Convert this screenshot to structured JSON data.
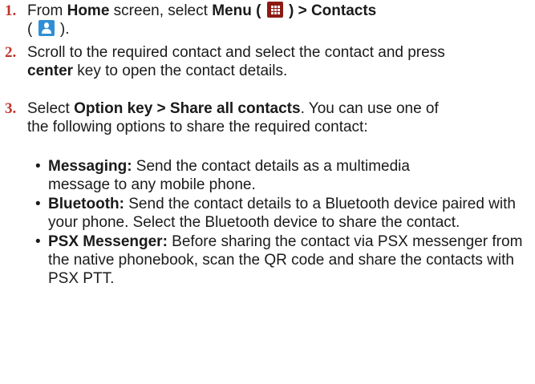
{
  "steps": [
    {
      "number": "1.",
      "text_from": "From ",
      "home": "Home",
      "text_screen": " screen, select ",
      "menu": "Menu",
      "open_paren": " ( ",
      "close_paren_bold": " ) > Contacts",
      "line2_open": "( ",
      "line2_close": " ).",
      "menu_icon": "menu-grid-icon",
      "contacts_icon": "contacts-person-icon"
    },
    {
      "number": "2.",
      "text_a": "Scroll to the required contact and select the contact and press ",
      "center": "center",
      "text_b": " key to open the contact details."
    },
    {
      "number": "3.",
      "text_a": "Select ",
      "option": "Option key > Share all contacts",
      "text_b": ". You can use one of the following options to share the required contact:"
    }
  ],
  "options": [
    {
      "bullet": "•",
      "label": "Messaging:",
      "text": " Send the contact details as a multimedia message to any mobile phone."
    },
    {
      "bullet": "•",
      "label": "Bluetooth:",
      "text": " Send the contact details to a Bluetooth device paired with your phone. Select the Bluetooth device to share the contact."
    },
    {
      "bullet": "•",
      "label": "PSX Messenger:",
      "text": " Before sharing the contact via PSX messenger from the native phonebook, scan the QR code and share the contacts with PSX PTT."
    }
  ],
  "colors": {
    "step_number": "#c0362c",
    "menu_icon_bg": "#8d1a12",
    "contacts_icon_bg": "#2e8fd6"
  }
}
